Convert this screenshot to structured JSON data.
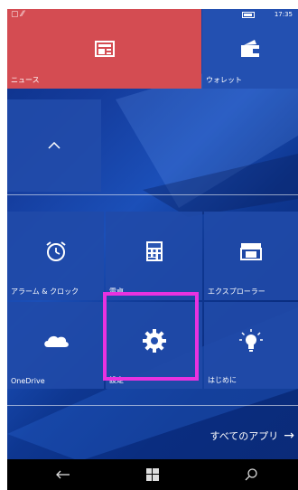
{
  "status": {
    "time": "17:35"
  },
  "tiles": {
    "news": "ニュース",
    "wallet": "ウォレット",
    "alarm": "アラーム & クロック",
    "calculator": "電卓",
    "explorer": "エクスプローラー",
    "onedrive": "OneDrive",
    "settings": "設定",
    "getstarted": "はじめに"
  },
  "all_apps": {
    "label": "すべてのアプリ",
    "arrow": "→"
  },
  "icons": {
    "news": "news-icon",
    "wallet": "wallet-icon",
    "collapse": "chevron-up-icon",
    "alarm": "alarm-clock-icon",
    "calculator": "calculator-icon",
    "explorer": "folder-icon",
    "onedrive": "cloud-icon",
    "settings": "gear-icon",
    "getstarted": "lightbulb-icon",
    "back": "back-arrow-icon",
    "home": "windows-logo-icon",
    "search": "search-icon"
  },
  "colors": {
    "news_tile": "#d44c52",
    "highlight": "#e832e0",
    "background": "#0b2f86"
  }
}
